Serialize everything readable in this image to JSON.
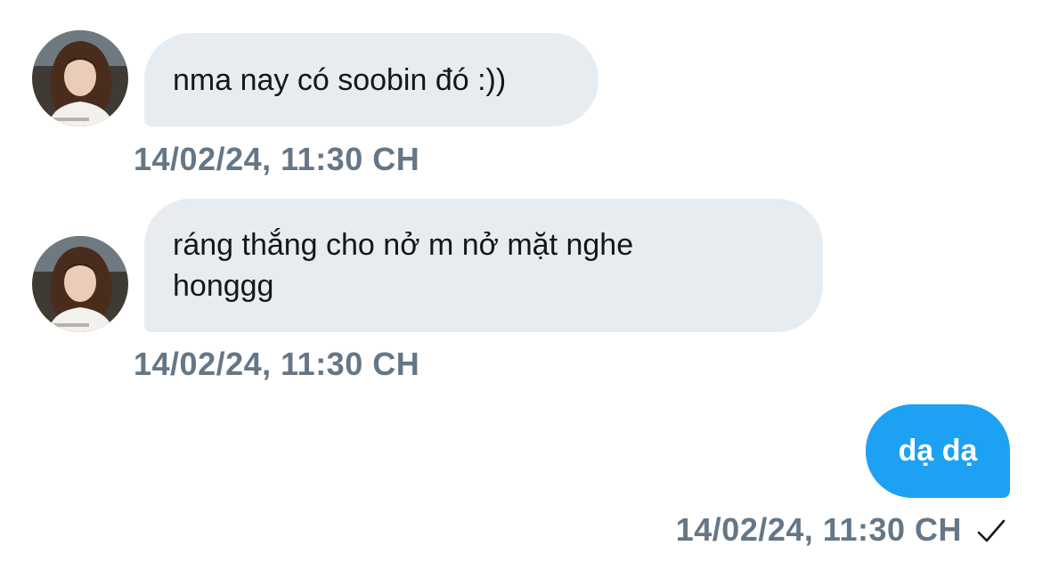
{
  "messages": [
    {
      "direction": "incoming",
      "text": "nma nay có soobin đó :))",
      "timestamp": "14/02/24, 11:30 CH"
    },
    {
      "direction": "incoming",
      "text": "ráng thắng cho nở m nở mặt nghe honggg",
      "timestamp": "14/02/24, 11:30 CH"
    },
    {
      "direction": "outgoing",
      "text": "dạ dạ",
      "timestamp": "14/02/24, 11:30 CH",
      "status_icon": "checkmark-icon"
    }
  ],
  "colors": {
    "incoming_bubble": "#e7ecf0",
    "outgoing_bubble": "#1da1f2",
    "timestamp": "#657786",
    "text": "#14171a"
  }
}
